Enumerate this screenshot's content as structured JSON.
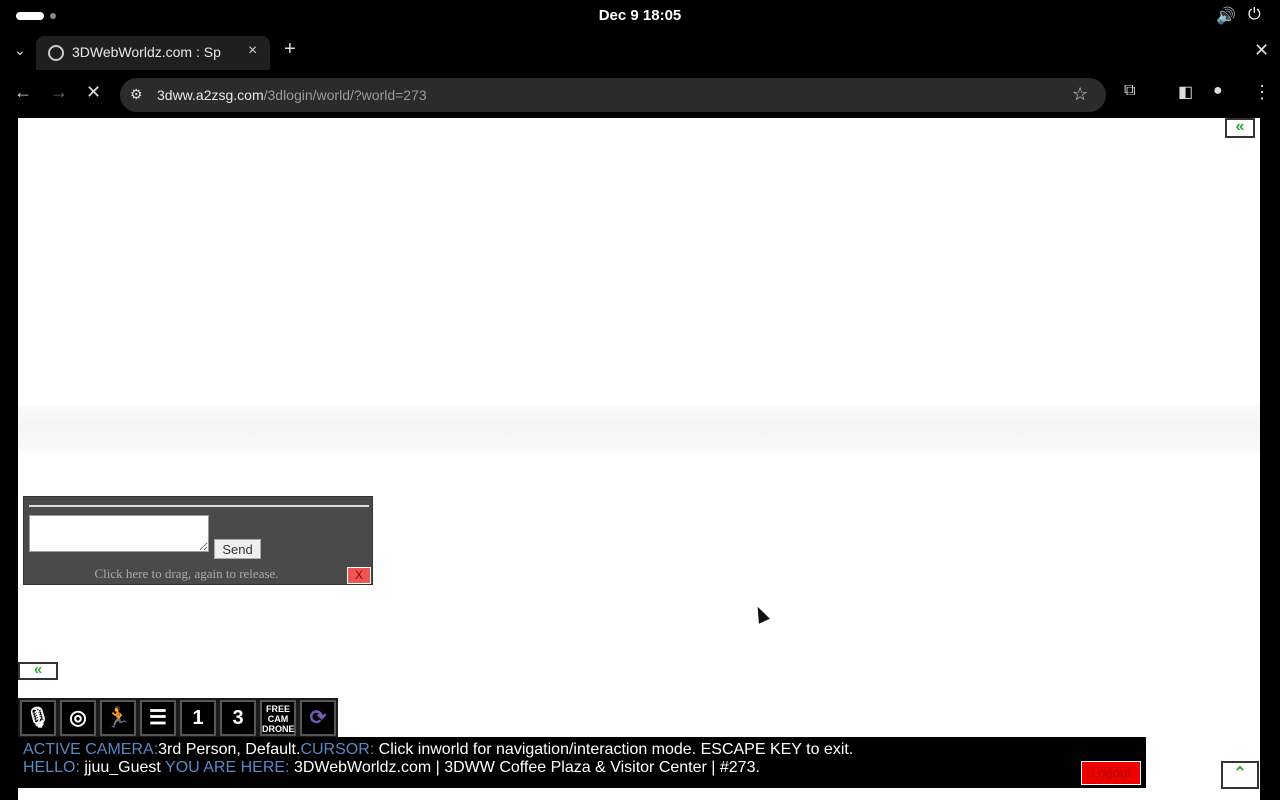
{
  "system_bar": {
    "clock": "Dec 9  18:05",
    "volume_icon": "volume-icon",
    "power_icon": "power-icon"
  },
  "browser": {
    "tab_title": "3DWebWorldz.com : Sp",
    "tab_close": "×",
    "new_tab": "+",
    "window_close": "✕",
    "url_host": "3dww.a2zsg.com",
    "url_path": "/3dlogin/world/?world=273"
  },
  "page": {
    "collapse_glyph": "«",
    "expand_glyph": "⌃",
    "chat": {
      "send_label": "Send",
      "drag_hint": "Click here to drag, again to release.",
      "close_label": "X",
      "message_value": ""
    },
    "toolbar": {
      "free_cam_line1": "FREE",
      "free_cam_line2": "CAM",
      "free_cam_line3": "DRONE",
      "first_person": "1",
      "third_person": "3"
    },
    "status": {
      "camera_key": "ACTIVE CAMERA:",
      "camera_value": "3rd Person, Default.",
      "cursor_key": "CURSOR:",
      "cursor_value": " Click inworld for navigation/interaction mode. ESCAPE KEY to exit.",
      "hello_key": "HELLO:",
      "hello_value": " jjuu_Guest ",
      "here_key": "YOU ARE HERE:",
      "here_value": " 3DWebWorldz.com | 3DWW Coffee Plaza & Visitor Center | #273."
    },
    "logout_label": "Logout"
  }
}
